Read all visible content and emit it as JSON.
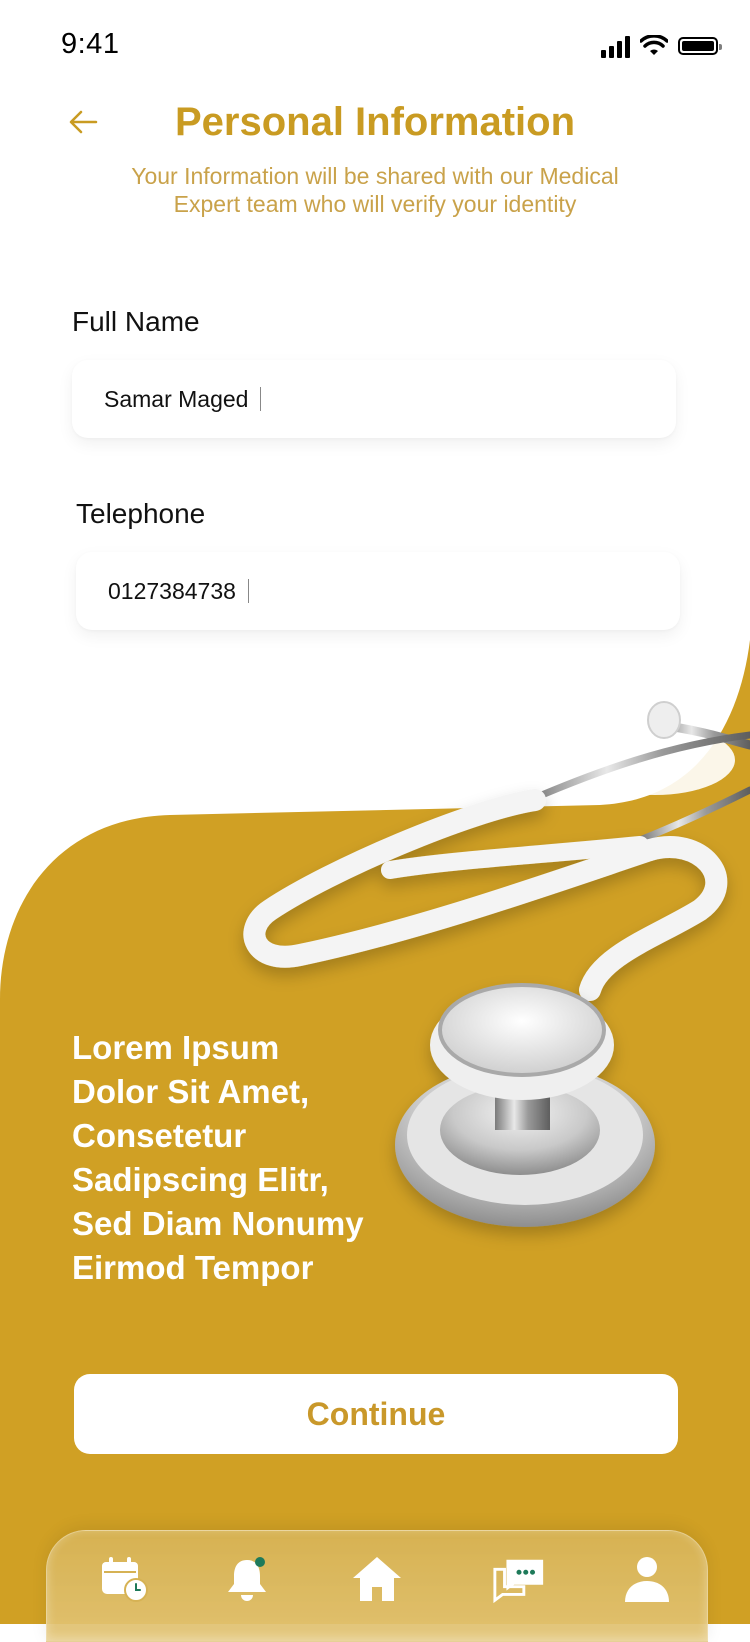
{
  "status_bar": {
    "time": "9:41"
  },
  "header": {
    "title": "Personal Information",
    "subtitle": "Your Information will be shared with our Medical Expert team who will verify your identity"
  },
  "form": {
    "full_name": {
      "label": "Full Name",
      "value": "Samar Maged"
    },
    "telephone": {
      "label": "Telephone",
      "value": "0127384738"
    }
  },
  "promo": {
    "text": "Lorem Ipsum Dolor Sit Amet, Consetetur Sadipscing Elitr, Sed Diam Nonumy Eirmod Tempor"
  },
  "actions": {
    "continue_label": "Continue"
  },
  "bottom_nav": {
    "items": [
      {
        "icon": "calendar-clock-icon"
      },
      {
        "icon": "bell-icon",
        "has_badge": true
      },
      {
        "icon": "home-icon",
        "active": true
      },
      {
        "icon": "chat-icon"
      },
      {
        "icon": "user-icon"
      }
    ]
  },
  "colors": {
    "accent": "#C99B22",
    "gold_background": "#D0A024",
    "subtitle": "#C9A24A",
    "badge": "#1E7A5A"
  }
}
